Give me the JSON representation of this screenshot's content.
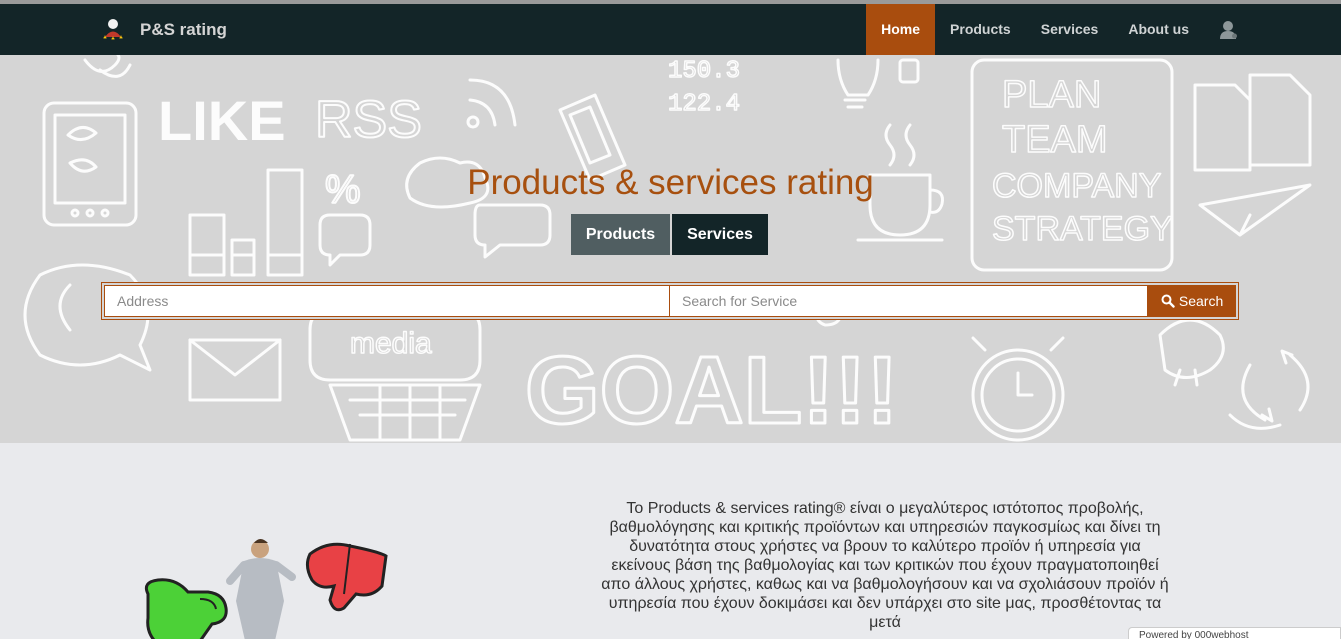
{
  "brand": {
    "name": "P&S rating"
  },
  "nav": {
    "items": [
      {
        "label": "Home",
        "active": true
      },
      {
        "label": "Products",
        "active": false
      },
      {
        "label": "Services",
        "active": false
      },
      {
        "label": "About us",
        "active": false
      }
    ],
    "user_icon": "user-icon"
  },
  "hero": {
    "title": "Products & services rating",
    "toggle": {
      "products": "Products",
      "services": "Services",
      "selected": "Services"
    },
    "search": {
      "address_placeholder": "Address",
      "service_placeholder": "Search for Service",
      "button": "Search"
    },
    "doodle_text": {
      "like": "LIKE",
      "rss": "RSS",
      "num1": "150.3",
      "num2": "122.4",
      "media": "media",
      "goal": "GOAL!!!",
      "plan": "PLAN",
      "team": "TEAM",
      "company": "COMPANY",
      "strategy": "STRATEGY"
    }
  },
  "about": {
    "text": "Το Products & services rating® είναι ο μεγαλύτερος ιστότοπος προβολής, βαθμολόγησης και κριτικής προϊόντων και υπηρεσιών παγκοσμίως και δίνει τη δυνατότητα στους χρήστες να βρουν το καλύτερο προϊόν ή υπηρεσία για εκείνους βάση της βαθμολογίας και των κριτικών που έχουν πραγματοποιηθεί απο άλλους χρήστες, καθως και να βαθμολογήσουν και να σχολιάσουν προϊόν ή υπηρεσία που έχουν δοκιμάσει και δεν υπάρχει στο site μας, προσθέτοντας τα μετά"
  },
  "footer": {
    "powered": "Powered by 000webhost"
  },
  "colors": {
    "accent": "#a94d0e",
    "navbar": "#132528",
    "toggle_products": "#505e61"
  }
}
